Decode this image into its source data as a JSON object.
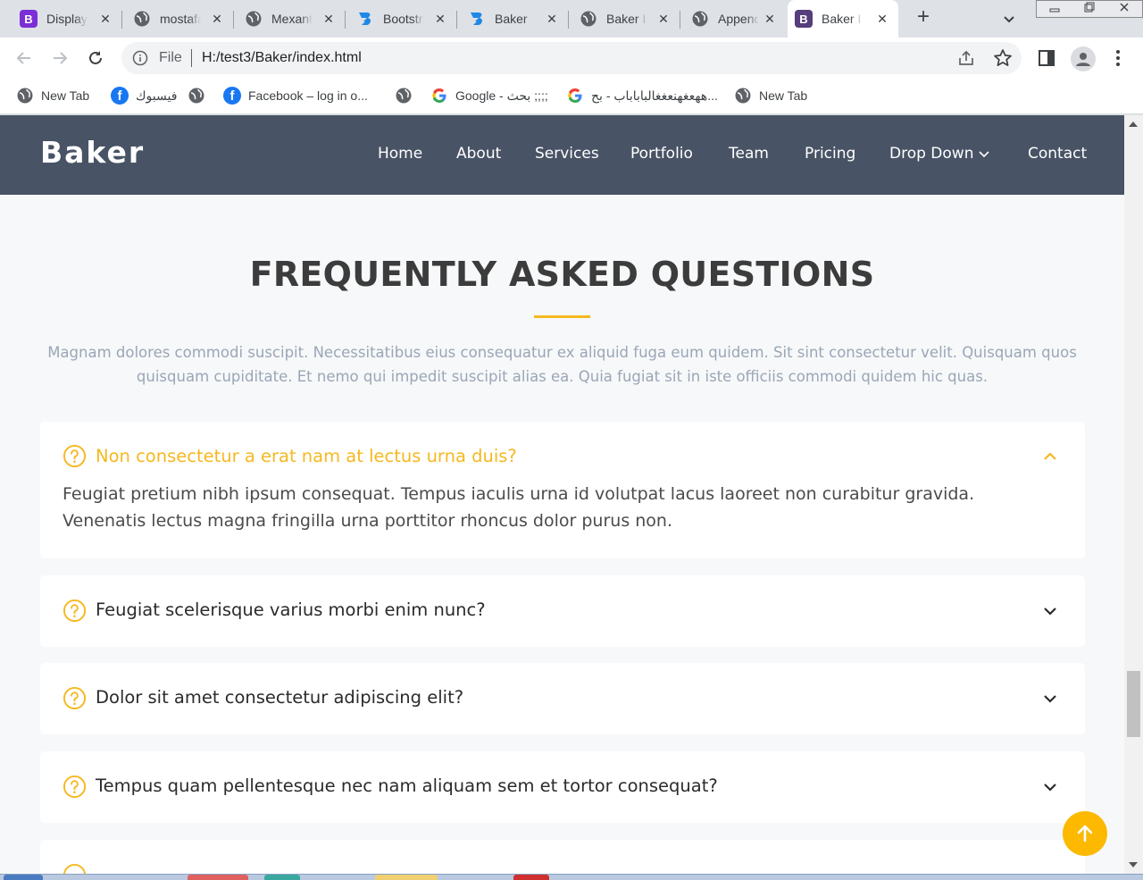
{
  "browser": {
    "tabs": [
      {
        "title": "Display",
        "icon": "bootstrap-icon"
      },
      {
        "title": "mostafa",
        "icon": "globe-icon"
      },
      {
        "title": "Mexant",
        "icon": "globe-icon"
      },
      {
        "title": "Bootstrap",
        "icon": "bootstrapmade-icon"
      },
      {
        "title": "Baker",
        "icon": "bootstrapmade-icon"
      },
      {
        "title": "Baker I",
        "icon": "globe-icon"
      },
      {
        "title": "Append",
        "icon": "globe-icon"
      },
      {
        "title": "Baker I",
        "icon": "bootstrap-icon",
        "active": true
      }
    ],
    "new_tab_symbol": "+",
    "close_symbol": "✕",
    "address": {
      "scheme": "File",
      "url": "H:/test3/Baker/index.html"
    },
    "bookmarks": [
      {
        "label": "New Tab",
        "icon": "globe-icon"
      },
      {
        "label": "فيسبوك",
        "icon": "facebook-icon"
      },
      {
        "label": "",
        "icon": "globe-icon"
      },
      {
        "label": "Facebook – log in o...",
        "icon": "facebook-icon"
      },
      {
        "label": "",
        "icon": "globe-icon"
      },
      {
        "label": "Google - بحث ;;;;",
        "icon": "google-icon"
      },
      {
        "label": "ههعغهنعغغالباباباب - بح...",
        "icon": "google-icon"
      },
      {
        "label": "New Tab",
        "icon": "globe-icon"
      }
    ]
  },
  "site": {
    "logo": "Baker",
    "nav": [
      "Home",
      "About",
      "Services",
      "Portfolio",
      "Team",
      "Pricing",
      "Drop Down",
      "Contact"
    ]
  },
  "faq": {
    "title": "FREQUENTLY ASKED QUESTIONS",
    "description": "Magnam dolores commodi suscipit. Necessitatibus eius consequatur ex aliquid fuga eum quidem. Sit sint consectetur velit. Quisquam quos quisquam cupiditate. Et nemo qui impedit suscipit alias ea. Quia fugiat sit in iste officiis commodi quidem hic quas.",
    "items": [
      {
        "question": "Non consectetur a erat nam at lectus urna duis?",
        "answer": "Feugiat pretium nibh ipsum consequat. Tempus iaculis urna id volutpat lacus laoreet non curabitur gravida. Venenatis lectus magna fringilla urna porttitor rhoncus dolor purus non.",
        "open": true
      },
      {
        "question": "Feugiat scelerisque varius morbi enim nunc?",
        "open": false
      },
      {
        "question": "Dolor sit amet consectetur adipiscing elit?",
        "open": false
      },
      {
        "question": "Tempus quam pellentesque nec nam aliquam sem et tortor consequat?",
        "open": false
      }
    ]
  },
  "colors": {
    "header_bg": "#485365",
    "accent": "#f5b821",
    "back_to_top": "#fcb900",
    "page_bg": "#f7f8f9"
  }
}
